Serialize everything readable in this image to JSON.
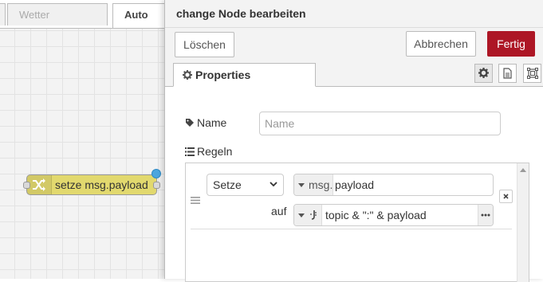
{
  "workspace": {
    "tabs": [
      {
        "label": ""
      },
      {
        "label": "Wetter"
      },
      {
        "label": "Auto"
      }
    ],
    "node": {
      "label": "setze msg.payload",
      "icon": "shuffle-icon",
      "color": "#e2d96e"
    }
  },
  "tray": {
    "title": "change Node bearbeiten",
    "toolbar": {
      "delete_label": "Löschen",
      "cancel_label": "Abbrechen",
      "done_label": "Fertig"
    },
    "tabs": {
      "properties_label": "Properties"
    },
    "form": {
      "name_label": "Name",
      "name_placeholder": "Name",
      "rules_label": "Regeln",
      "rule": {
        "action": "Setze",
        "target_type": "msg.",
        "target_value": "payload",
        "to_label": "auf",
        "value_type_icon": "jsonata-icon",
        "value": "topic & \":\" & payload"
      }
    }
  },
  "colors": {
    "primary": "#ad1625",
    "changed_indicator": "#4da6de"
  }
}
